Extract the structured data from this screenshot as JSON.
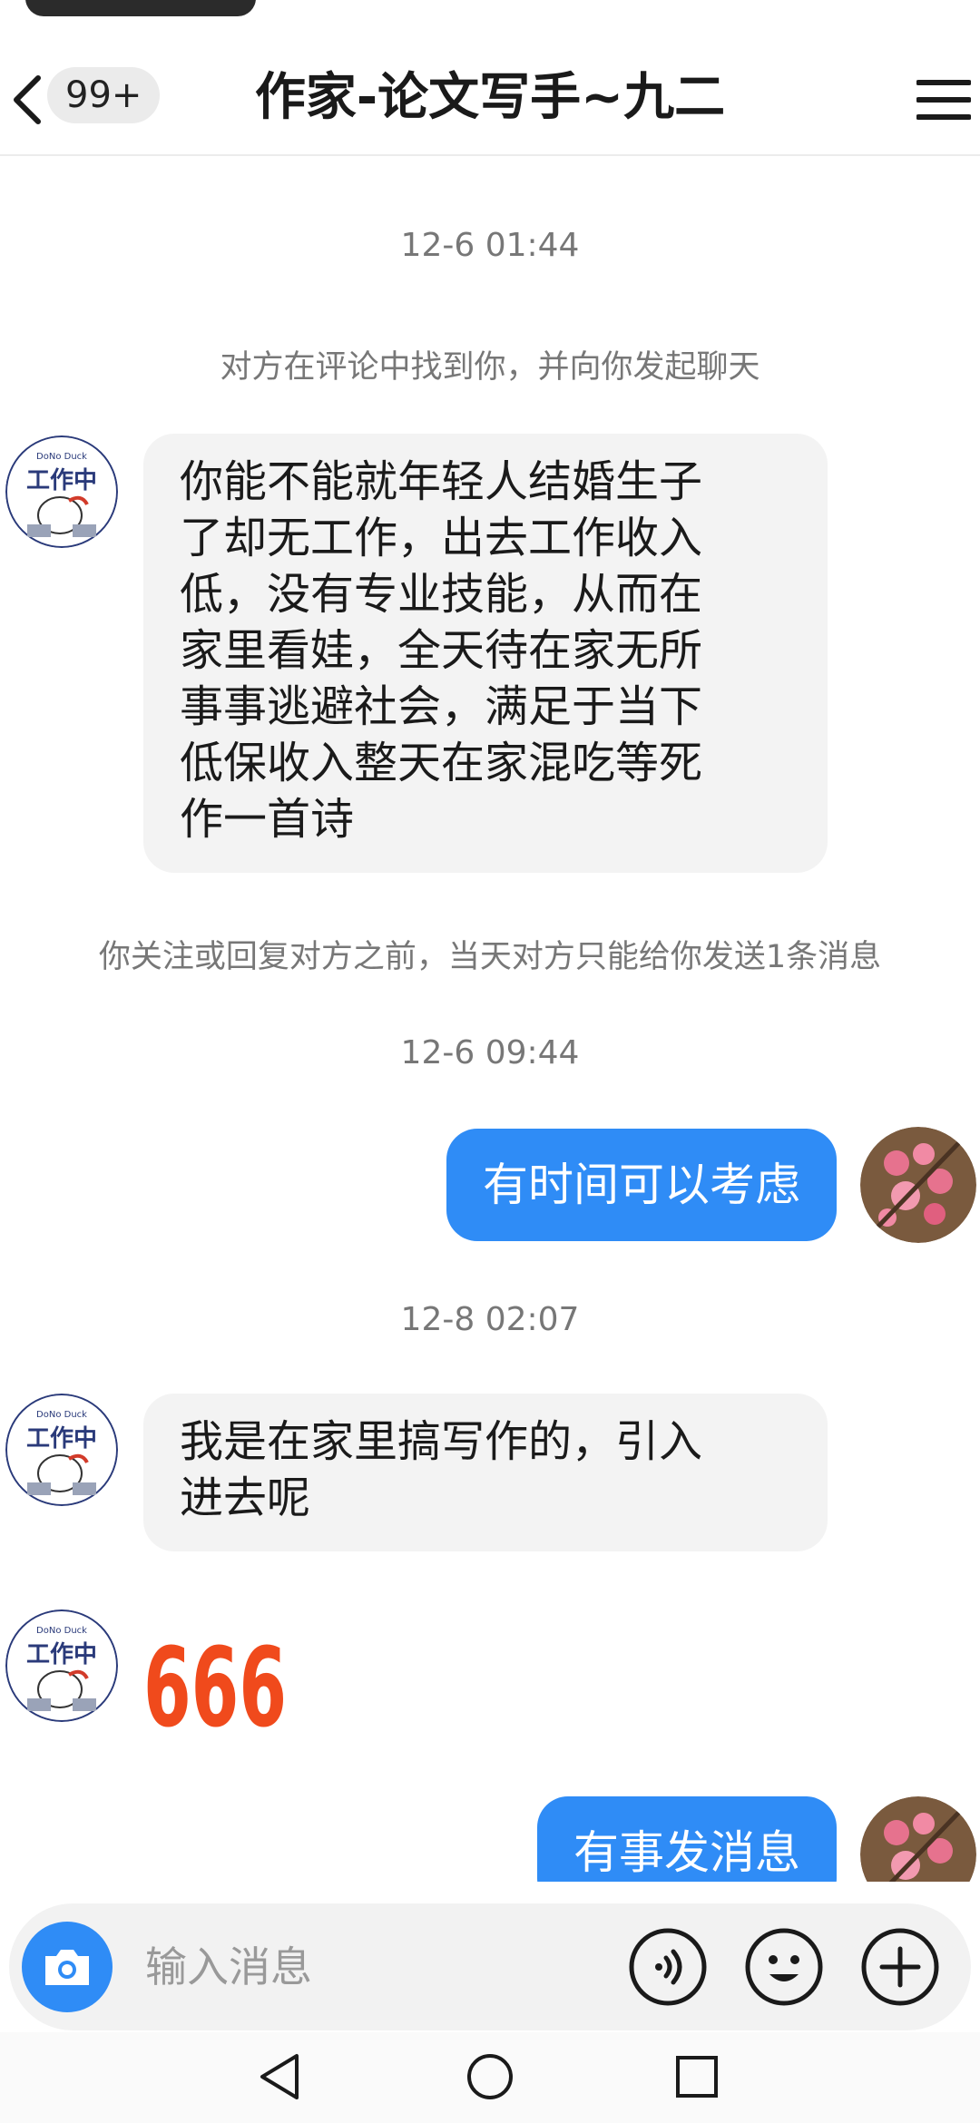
{
  "header": {
    "unread_badge": "99+",
    "title": "作家-论文写手~九二"
  },
  "messages": {
    "timestamp_1": "12-6 01:44",
    "system_notice_1": "对方在评论中找到你，并向你发起聊天",
    "incoming_1_lines": [
      "你能不能就年轻人结婚生子",
      "了却无工作，出去工作收入",
      "低，没有专业技能，从而在",
      "家里看娃，全天待在家无所",
      "事事逃避社会，满足于当下",
      "低保收入整天在家混吃等死",
      "作一首诗"
    ],
    "system_notice_2": "你关注或回复对方之前，当天对方只能给你发送1条消息",
    "timestamp_2": "12-6 09:44",
    "outgoing_1": "有时间可以考虑",
    "timestamp_3": "12-8 02:07",
    "incoming_2_lines": [
      "我是在家里搞写作的，引入",
      "进去呢"
    ],
    "sticker_text": "666",
    "outgoing_2": "有事发消息"
  },
  "avatar_left": {
    "badge_text": "工作中",
    "brand_text": "DoNo Duck"
  },
  "input_bar": {
    "placeholder": "输入消息"
  },
  "colors": {
    "accent": "#2f8cf6",
    "incoming_bubble": "#f3f3f3",
    "system_text": "#777777"
  },
  "icons": {
    "back": "chevron-left-icon",
    "menu": "hamburger-menu-icon",
    "camera": "camera-icon",
    "voice": "voice-icon",
    "emoji": "emoji-icon",
    "plus": "plus-icon",
    "nav_back": "triangle-back-icon",
    "nav_home": "circle-home-icon",
    "nav_recent": "square-recent-icon"
  }
}
